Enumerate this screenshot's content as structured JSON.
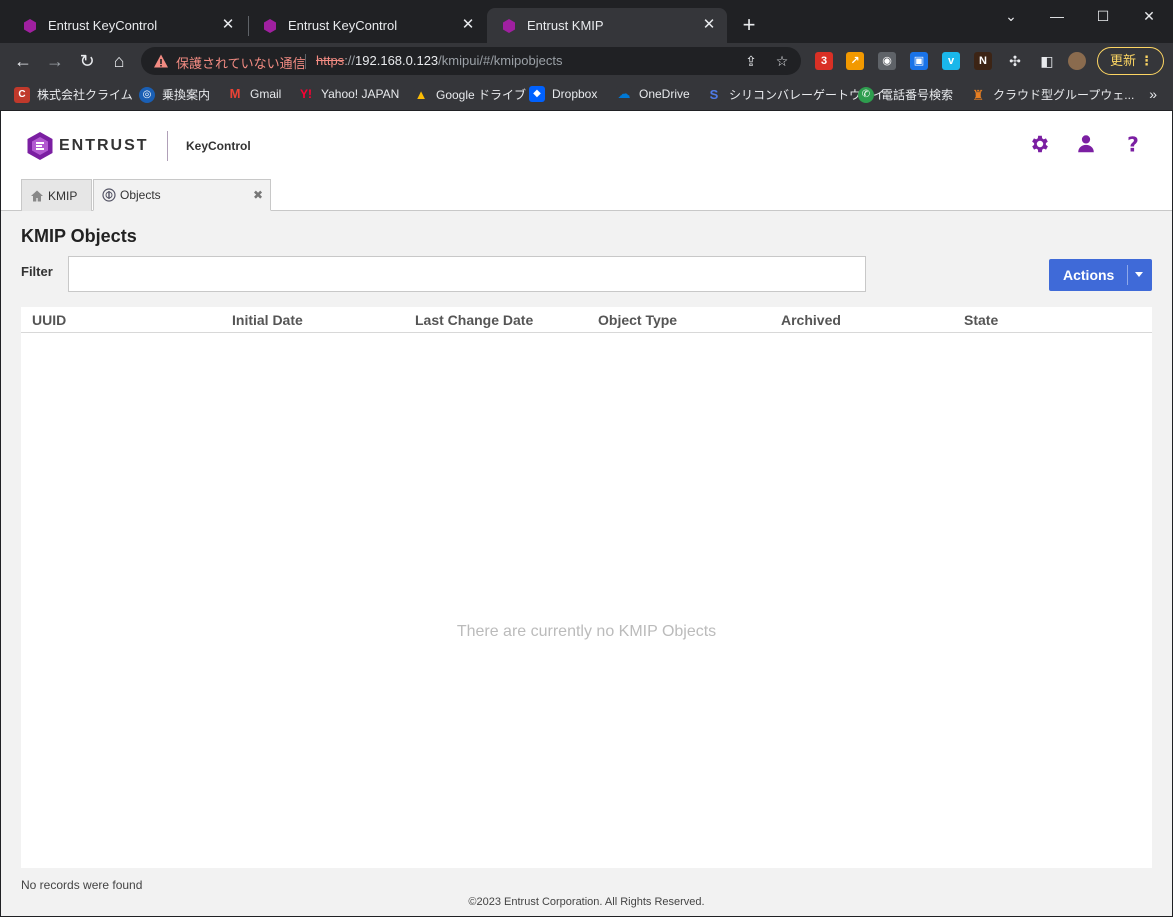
{
  "browser": {
    "tabs": [
      {
        "title": "Entrust KeyControl",
        "active": false
      },
      {
        "title": "Entrust KeyControl",
        "active": false
      },
      {
        "title": "Entrust KMIP",
        "active": true
      }
    ],
    "window_controls": {
      "minimize": "—",
      "maximize": "☐",
      "close": "✕",
      "tab_search": "⌄"
    },
    "address_bar": {
      "security_warning": "保護されていない通信",
      "url_scheme": "https",
      "url_host": "192.168.0.123",
      "url_path": "/kmipui/#/kmipobjects"
    },
    "extension_badge": "3",
    "update_button": "更新",
    "bookmarks": [
      {
        "label": "株式会社クライム",
        "icon": "climb-icon",
        "color": "#c0392b"
      },
      {
        "label": "乗換案内",
        "icon": "transit-icon",
        "color": "#1a5fb4"
      },
      {
        "label": "Gmail",
        "icon": "gmail-icon",
        "color": "#ea4335"
      },
      {
        "label": "Yahoo! JAPAN",
        "icon": "yahoo-icon",
        "color": "#ff0033"
      },
      {
        "label": "Google ドライブ",
        "icon": "drive-icon",
        "color": "#1fa463"
      },
      {
        "label": "Dropbox",
        "icon": "dropbox-icon",
        "color": "#0061fe"
      },
      {
        "label": "OneDrive",
        "icon": "onedrive-icon",
        "color": "#0078d4"
      },
      {
        "label": "シリコンバレーゲートウェイ",
        "icon": "svg-icon",
        "color": "#1a3fa3"
      },
      {
        "label": "電話番号検索",
        "icon": "phone-search-icon",
        "color": "#2e9d4e"
      },
      {
        "label": "クラウド型グループウェ...",
        "icon": "groupware-icon",
        "color": "#e67e22"
      }
    ],
    "bookmarks_more": "»"
  },
  "app": {
    "brand": "ENTRUST",
    "product": "KeyControl",
    "brand_color": "#7b1fa2",
    "page_tabs": [
      {
        "label": "KMIP",
        "icon": "home-icon",
        "active": false
      },
      {
        "label": "Objects",
        "icon": "objects-icon",
        "active": true,
        "closable": true
      }
    ],
    "page_title": "KMIP Objects",
    "filter": {
      "label": "Filter",
      "value": "",
      "placeholder": ""
    },
    "actions_label": "Actions",
    "accent_color": "#3f6ad8",
    "table": {
      "columns": [
        "UUID",
        "Initial Date",
        "Last Change Date",
        "Object Type",
        "Archived",
        "State"
      ],
      "rows": [],
      "empty_message": "There are currently no KMIP Objects"
    },
    "status_text": "No records were found",
    "footer": "©2023 Entrust Corporation. All Rights Reserved."
  }
}
